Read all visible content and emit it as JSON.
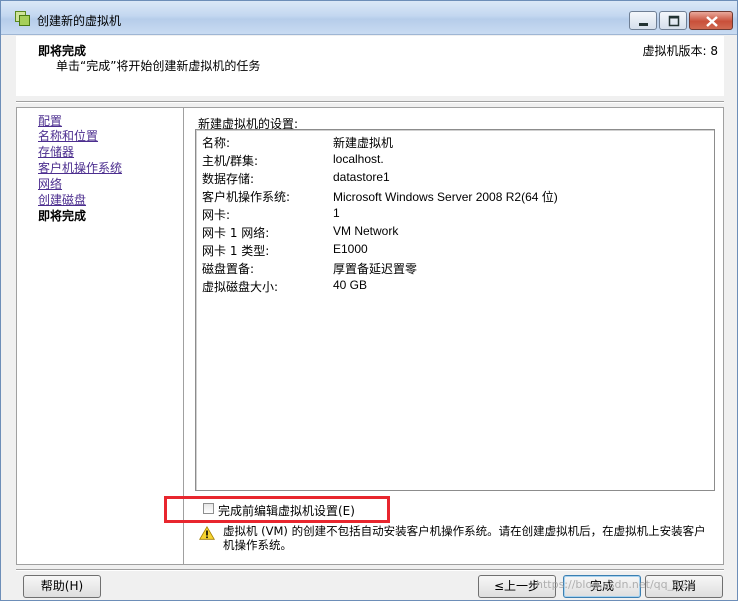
{
  "window": {
    "title": "创建新的虚拟机"
  },
  "header": {
    "title": "即将完成",
    "subtitle": "单击“完成”将开始创建新虚拟机的任务",
    "version": "虚拟机版本: 8"
  },
  "nav": {
    "items": [
      {
        "label": "配置",
        "current": false
      },
      {
        "label": "名称和位置",
        "current": false
      },
      {
        "label": "存储器",
        "current": false
      },
      {
        "label": "客户机操作系统",
        "current": false
      },
      {
        "label": "网络",
        "current": false
      },
      {
        "label": "创建磁盘",
        "current": false
      },
      {
        "label": "即将完成",
        "current": true
      }
    ]
  },
  "settings": {
    "label": "新建虚拟机的设置:",
    "rows": [
      {
        "key": "名称:",
        "value": "新建虚拟机"
      },
      {
        "key": "主机/群集:",
        "value": "localhost."
      },
      {
        "key": "数据存储:",
        "value": "datastore1"
      },
      {
        "key": "客户机操作系统:",
        "value": "Microsoft Windows Server 2008 R2(64 位)"
      },
      {
        "key": "网卡:",
        "value": "1"
      },
      {
        "key": "网卡 1 网络:",
        "value": "VM Network"
      },
      {
        "key": "网卡 1 类型:",
        "value": "E1000"
      },
      {
        "key": "磁盘置备:",
        "value": "厚置备延迟置零"
      },
      {
        "key": "虚拟磁盘大小:",
        "value": "40 GB"
      }
    ]
  },
  "edit_checkbox": {
    "label": "完成前编辑虚拟机设置(E)",
    "checked": false
  },
  "warning": {
    "text": "虚拟机 (VM) 的创建不包括自动安装客户机操作系统。请在创建虚拟机后，在虚拟机上安装客户机操作系统。"
  },
  "buttons": {
    "help": "帮助(H)",
    "back": "≤上一步",
    "finish": "完成",
    "cancel": "取消"
  },
  "watermark": "https://blog.csdn.net/qq_42"
}
